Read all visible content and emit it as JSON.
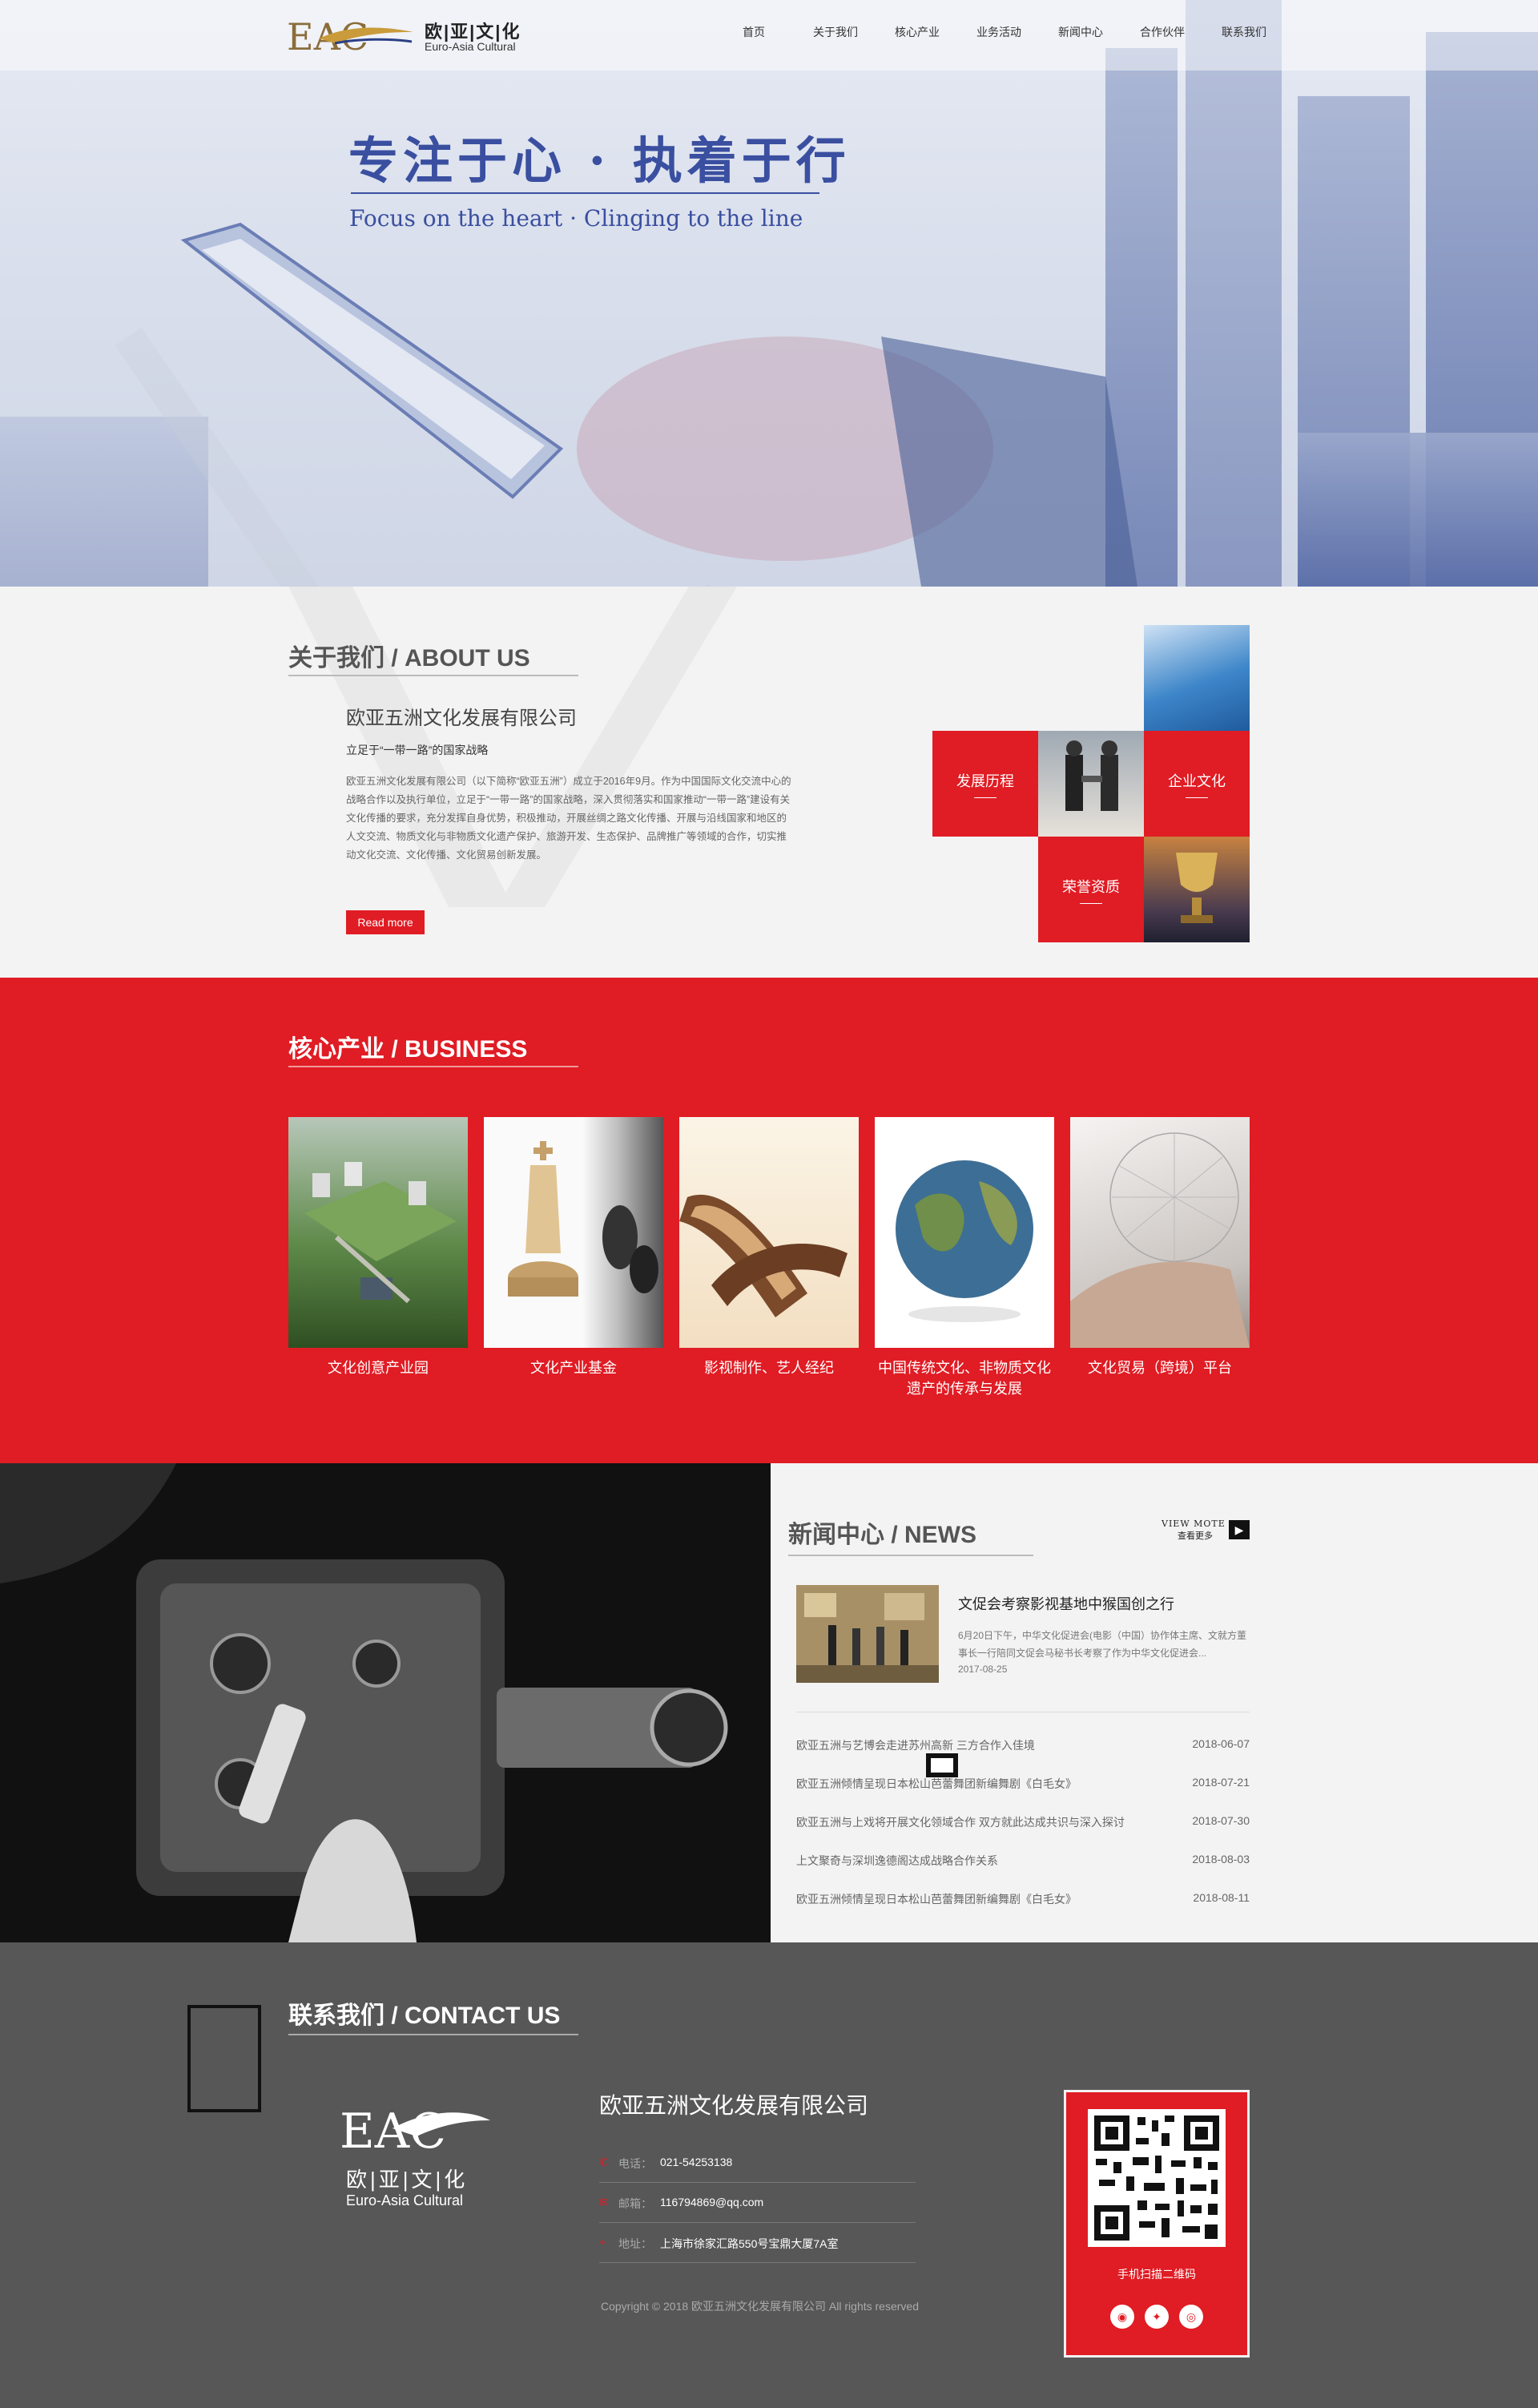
{
  "header": {
    "logo_cn": "欧|亚|文|化",
    "logo_en": "Euro-Asia Cultural",
    "nav": [
      "首页",
      "关于我们",
      "核心产业",
      "业务活动",
      "新闻中心",
      "合作伙伴",
      "联系我们"
    ]
  },
  "hero": {
    "title": "专注于心 · 执着于行",
    "subtitle": "Focus on the heart · Clinging to the line"
  },
  "about": {
    "title": "关于我们 / ABOUT US",
    "company": "欧亚五洲文化发展有限公司",
    "slogan": "立足于“一带一路”的国家战略",
    "description": "欧亚五洲文化发展有限公司（以下简称“欧亚五洲”）成立于2016年9月。作为中国国际文化交流中心的战略合作以及执行单位，立足于“一带一路”的国家战略，深入贯彻落实和国家推动“一带一路”建设有关文化传播的要求，充分发挥自身优势，积极推动，开展丝绸之路文化传播、开展与沿线国家和地区的人文交流、物质文化与非物质文化遗产保护、旅游开发、生态保护、品牌推广等领域的合作，切实推动文化交流、文化传播、文化贸易创新发展。",
    "read_more": "Read more",
    "tiles": [
      "发展历程",
      "企业文化",
      "荣誉资质"
    ]
  },
  "business": {
    "title": "核心产业 / BUSINESS",
    "items": [
      "文化创意产业园",
      "文化产业基金",
      "影视制作、艺人经纪",
      "中国传统文化、非物质文化遗产的传承与发展",
      "文化贸易（跨境）平台"
    ]
  },
  "news": {
    "title": "新闻中心 / NEWS",
    "view_more_en": "VIEW MOTE",
    "view_more_cn": "查看更多",
    "featured": {
      "title": "文促会考察影视基地中猴国创之行",
      "desc": "6月20日下午，中华文化促进会(电影（中国）协作体主席、文就方董事长一行陪同文促会马秘书长考察了作为中华文化促进会...",
      "date": "2017-08-25"
    },
    "list": [
      {
        "title": "欧亚五洲与艺博会走进苏州高新 三方合作入佳境",
        "date": "2018-06-07"
      },
      {
        "title": "欧亚五洲倾情呈现日本松山芭蕾舞团新编舞剧《白毛女》",
        "date": "2018-07-21"
      },
      {
        "title": "欧亚五洲与上戏将开展文化领域合作 双方就此达成共识与深入探讨",
        "date": "2018-07-30"
      },
      {
        "title": "上文聚奇与深圳逸德阁达成战略合作关系",
        "date": "2018-08-03"
      },
      {
        "title": "欧亚五洲倾情呈现日本松山芭蕾舞团新编舞剧《白毛女》",
        "date": "2018-08-11"
      }
    ]
  },
  "contact": {
    "title": "联系我们 / CONTACT US",
    "logo_cn": "欧|亚|文|化",
    "logo_en": "Euro-Asia Cultural",
    "company": "欧亚五洲文化发展有限公司",
    "phone_label": "电话：",
    "phone": "021-54253138",
    "email_label": "邮箱：",
    "email": "116794869@qq.com",
    "address_label": "地址：",
    "address": "上海市徐家汇路550号宝鼎大厦7A室",
    "copyright": "Copyright © 2018  欧亚五洲文化发展有限公司  All rights reserved",
    "qr_caption": "手机扫描二维码"
  },
  "colors": {
    "accent": "#e01c24",
    "hero_text": "#3a4fa0",
    "footer_bg": "#575757"
  }
}
